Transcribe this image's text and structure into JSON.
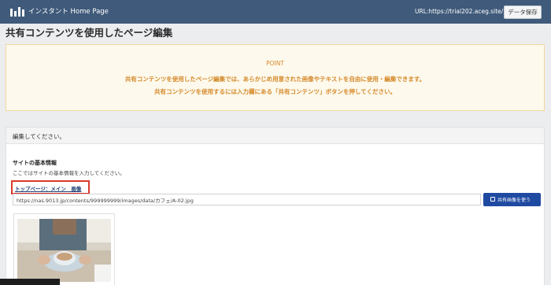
{
  "header": {
    "logo_text": "インスタント Home Page",
    "url": "URL:https://trial202.aceg.site/",
    "save_button": "データ保存"
  },
  "page": {
    "title": "共有コンテンツを使用したページ編集"
  },
  "point": {
    "title": "POINT",
    "line1": "共有コンテンツを使用したページ編集では、あらかじめ用意された画像やテキストを自由に使用・編集できます。",
    "line2": "共有コンテンツを使用するには入力欄にある「共有コンテンツ」ボタンを押してください。"
  },
  "panel": {
    "header": "編集してください。",
    "section_heading": "サイトの基本情報",
    "section_desc": "ここではサイトの基本情報を入力してください。",
    "field_label": "トップページ：メイン　画像",
    "field_value": "https://nas.9013.jp/contents/999999999/images/data/カフェ/A-02.jpg",
    "use_button": "共有画像を使う"
  },
  "colors": {
    "header_bg": "#3f5a7a",
    "point_text": "#d58a2b",
    "highlight_border": "#d93a2c",
    "button_blue": "#1f4aa2"
  }
}
